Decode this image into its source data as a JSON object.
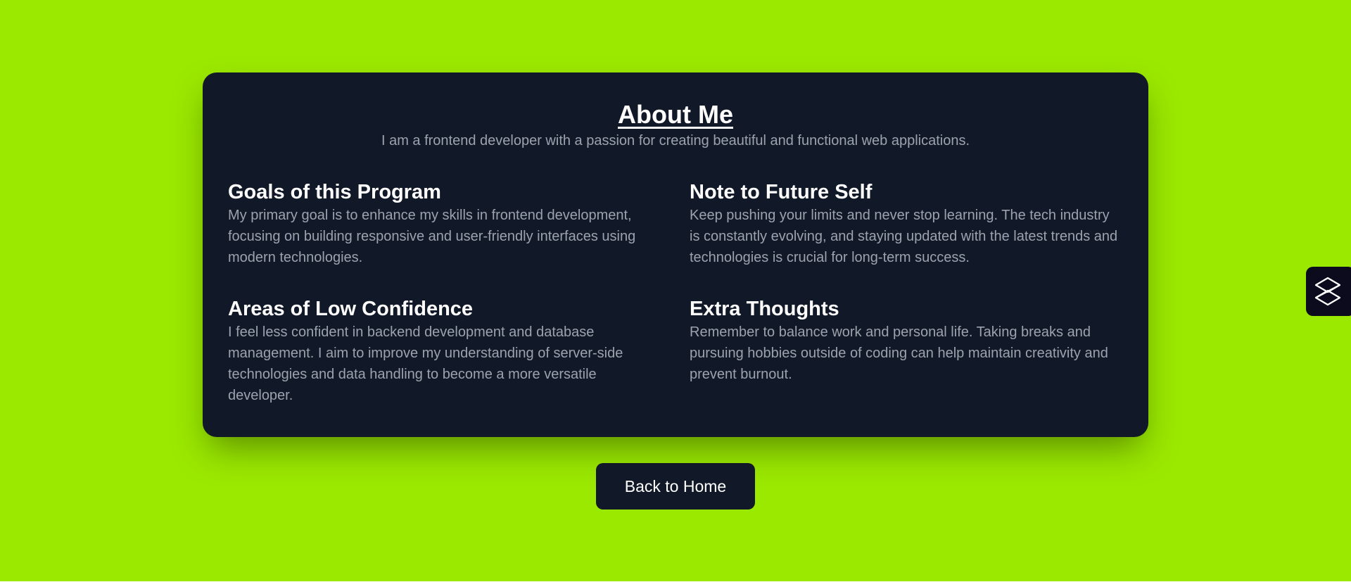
{
  "about": {
    "title": "About Me",
    "intro": "I am a frontend developer with a passion for creating beautiful and functional web applications."
  },
  "sections": [
    {
      "title": "Goals of this Program",
      "body": "My primary goal is to enhance my skills in frontend development, focusing on building responsive and user-friendly interfaces using modern technologies."
    },
    {
      "title": "Note to Future Self",
      "body": "Keep pushing your limits and never stop learning. The tech industry is constantly evolving, and staying updated with the latest trends and technologies is crucial for long-term success."
    },
    {
      "title": "Areas of Low Confidence",
      "body": "I feel less confident in backend development and database management. I aim to improve my understanding of server-side technologies and data handling to become a more versatile developer."
    },
    {
      "title": "Extra Thoughts",
      "body": "Remember to balance work and personal life. Taking breaks and pursuing hobbies outside of coding can help maintain creativity and prevent burnout."
    }
  ],
  "back_button": {
    "label": "Back to Home"
  },
  "side_widget": {
    "icon": "stacked-layers-icon"
  },
  "colors": {
    "page_background": "#9be800",
    "card_background": "#111827",
    "heading_text": "#ffffff",
    "body_text": "#9ca3af",
    "widget_background": "#0b0b1d"
  }
}
